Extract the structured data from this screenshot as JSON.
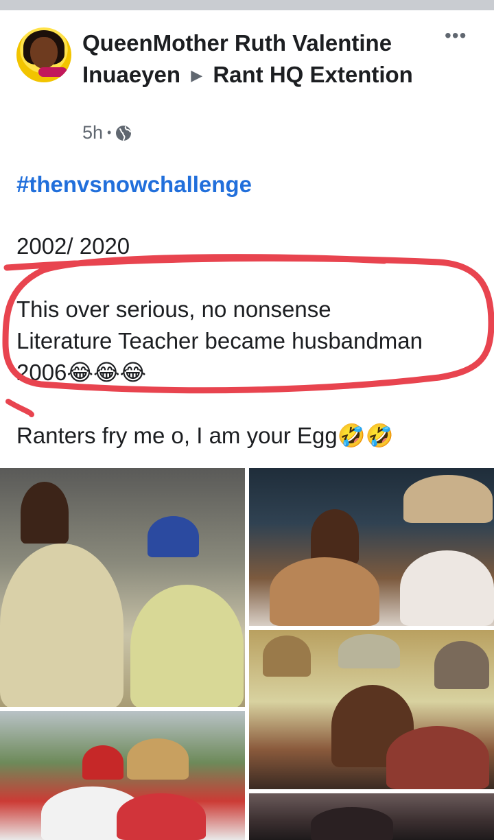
{
  "post": {
    "author": {
      "name": "QueenMother Ruth Valentine Inuaeyen",
      "arrow": "▶",
      "group": "Rant HQ Extention",
      "avatar_icon": "profile-photo"
    },
    "meta": {
      "time": "5h",
      "separator": "•",
      "privacy_icon": "globe-icon"
    },
    "more_icon": "•••",
    "hashtag": "#thenvsnowchallenge",
    "years": "2002/ 2020",
    "paragraph_line1": "This over serious, no nonsense",
    "paragraph_line2": "Literature Teacher became husbandman",
    "paragraph_line3_text": "2006",
    "paragraph_line3_emoji": "😂😂😂",
    "ranters_text": "Ranters fry me o, I am your Egg",
    "ranters_emoji": "🤣🤣",
    "photo_count": 5
  },
  "colors": {
    "hashtag": "#216fdb",
    "highlight_ink": "#e8444f",
    "meta_text": "#606770"
  }
}
